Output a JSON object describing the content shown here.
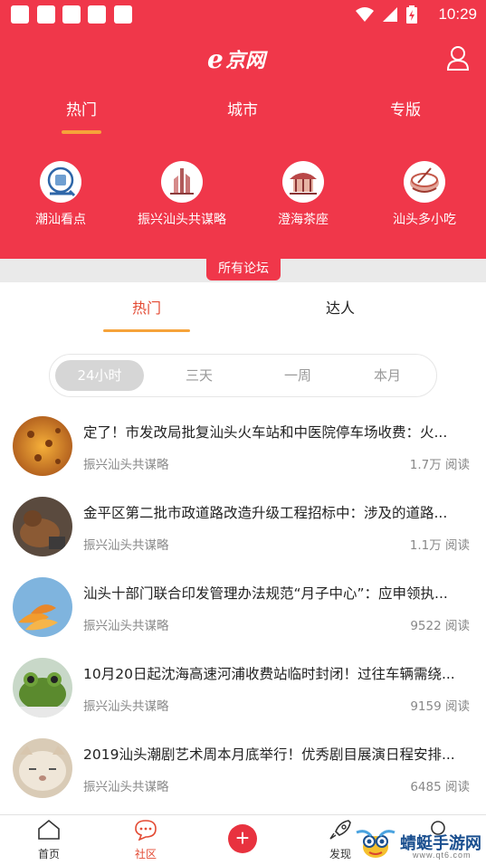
{
  "status_bar": {
    "time": "10:29",
    "notification_icons": 5
  },
  "app": {
    "logo_text": "e京网"
  },
  "top_tabs": [
    {
      "label": "热门",
      "active": true
    },
    {
      "label": "城市",
      "active": false
    },
    {
      "label": "专版",
      "active": false
    }
  ],
  "quick_links": [
    {
      "label": "潮汕看点",
      "icon": "news-reader-icon"
    },
    {
      "label": "振兴汕头共谋略",
      "icon": "city-tower-icon"
    },
    {
      "label": "澄海茶座",
      "icon": "pavilion-icon"
    },
    {
      "label": "汕头多小吃",
      "icon": "food-bowl-icon"
    }
  ],
  "section_label": "所有论坛",
  "sub_tabs": [
    {
      "label": "热门",
      "active": true
    },
    {
      "label": "达人",
      "active": false
    }
  ],
  "time_filters": [
    {
      "label": "24小时",
      "active": true
    },
    {
      "label": "三天",
      "active": false
    },
    {
      "label": "一周",
      "active": false
    },
    {
      "label": "本月",
      "active": false
    }
  ],
  "posts": [
    {
      "title": "定了！市发改局批复汕头火车站和中医院停车场收费：火...",
      "source": "振兴汕头共谋略",
      "reads": "1.7万 阅读",
      "thumb": "orange-texture"
    },
    {
      "title": "金平区第二批市政道路改造升级工程招标中：涉及的道路...",
      "source": "振兴汕头共谋略",
      "reads": "1.1万 阅读",
      "thumb": "dog-photo"
    },
    {
      "title": "汕头十部门联合印发管理办法规范“月子中心”：应申领执...",
      "source": "振兴汕头共谋略",
      "reads": "9522 阅读",
      "thumb": "flower-photo"
    },
    {
      "title": "10月20日起沈海高速河浦收费站临时封闭！过往车辆需绕...",
      "source": "振兴汕头共谋略",
      "reads": "9159 阅读",
      "thumb": "frog-photo"
    },
    {
      "title": "2019汕头潮剧艺术周本月底举行！优秀剧目展演日程安排...",
      "source": "振兴汕头共谋略",
      "reads": "6485 阅读",
      "thumb": "cat-photo"
    }
  ],
  "bottom_nav": [
    {
      "label": "首页",
      "icon": "home-icon",
      "active": false
    },
    {
      "label": "社区",
      "icon": "chat-bubble-icon",
      "active": true
    },
    {
      "label": "",
      "icon": "plus-icon",
      "active": false
    },
    {
      "label": "发现",
      "icon": "rocket-icon",
      "active": false
    },
    {
      "label": "",
      "icon": "profile-icon",
      "active": false
    }
  ],
  "watermark": {
    "text": "蜻蜓手游网",
    "sub": "www.qt6.com"
  },
  "colors": {
    "brand_red": "#f0374a",
    "accent_orange": "#f6a33a",
    "active_text": "#e34a33"
  }
}
